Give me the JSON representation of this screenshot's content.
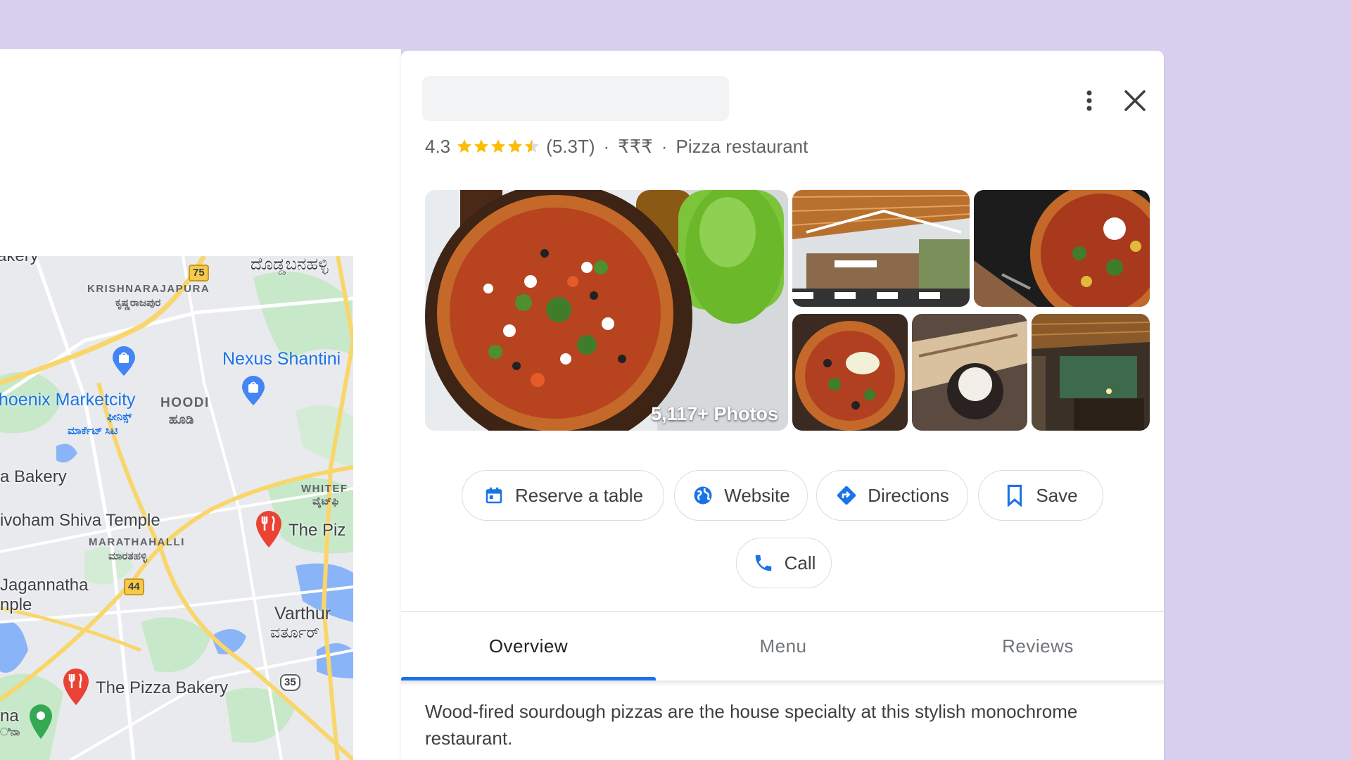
{
  "map": {
    "labels": {
      "bakery_top": "akery",
      "kn_top": "ದೊಡ್ಡಬನಹಳ್ಳಿ",
      "krishnarajapura": "KRISHNARAJAPURA",
      "krishnarajapura_kn": "ಕೃಷ್ಣರಾಜಪುರ",
      "nexus": "Nexus Shantini",
      "phoenix": "hoenix Marketcity",
      "phoenix_kn": "ಫೀನಿಕ್ಸ್",
      "phoenix_kn2": "ಮಾರ್ಕೆಟ್ ಸಿಟಿ",
      "hoodi": "HOODI",
      "hoodi_kn": "ಹೂಡಿ",
      "bakery_left": "a Bakery",
      "whitefield": "WHITEF",
      "whitefield_kn": "ವೈಟ್‌ಫಿ",
      "shiva": "ivoham Shiva Temple",
      "pizza_right": "The Piz",
      "marathahalli": "MARATHAHALLI",
      "marathahalli_kn": "ಮಾರತಹಳ್ಳಿ",
      "jagannatha": "Jagannatha",
      "temple": "nple",
      "varthur": "Varthur",
      "varthur_kn": "ವರ್ತೂರ್",
      "pizza_bakery": "The Pizza Bakery",
      "ana": "na",
      "ana_kn": "ಿನಾ"
    },
    "shields": {
      "nh75": "75",
      "nh44": "44",
      "sh35": "35"
    }
  },
  "place": {
    "rating": "4.3",
    "rating_value": 4.3,
    "review_count": "(5.3T)",
    "sep1": "·",
    "price": "₹₹₹",
    "sep2": "·",
    "category": "Pizza restaurant",
    "photo_count": "5,117+ Photos"
  },
  "actions": {
    "reserve": "Reserve a table",
    "website": "Website",
    "directions": "Directions",
    "save": "Save",
    "call": "Call"
  },
  "tabs": {
    "overview": "Overview",
    "menu": "Menu",
    "reviews": "Reviews"
  },
  "description": "Wood-fired sourdough pizzas are the house specialty at this stylish monochrome restaurant.",
  "colors": {
    "accent": "#1a73e8",
    "star": "#fbbc04",
    "background": "#d9d0f0",
    "pin_red": "#ea4335"
  },
  "icons": {
    "more": "more-vert-icon",
    "close": "close-icon",
    "reserve": "calendar-icon",
    "website": "globe-icon",
    "directions": "directions-icon",
    "save": "bookmark-icon",
    "call": "phone-icon"
  }
}
